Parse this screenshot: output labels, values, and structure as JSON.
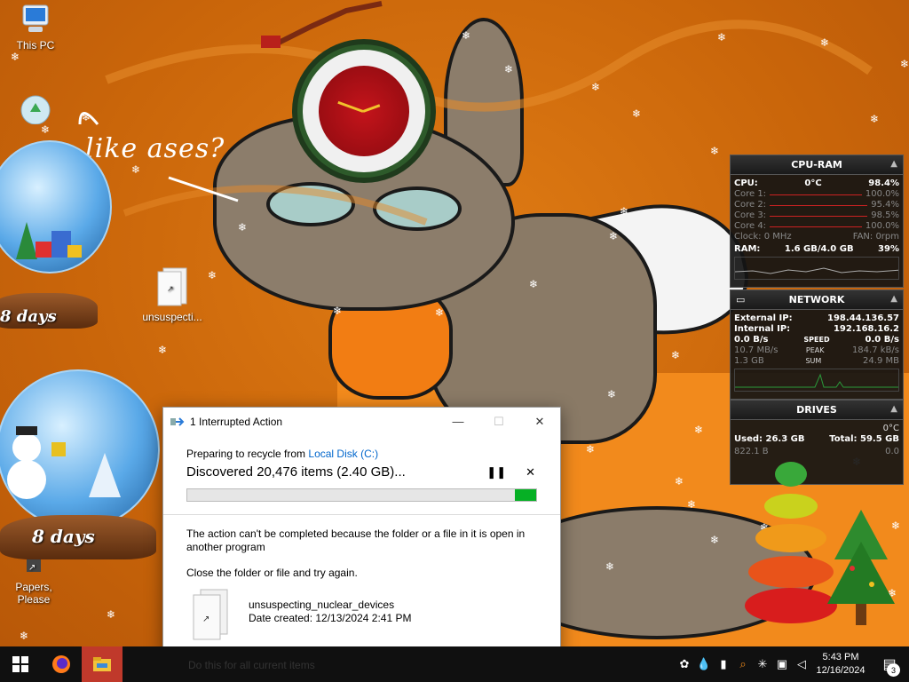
{
  "desktop": {
    "icons": [
      {
        "label": "This PC"
      },
      {
        "label": ""
      },
      {
        "label": "unsuspecti..."
      },
      {
        "label": "Papers, Please"
      }
    ],
    "handwriting": "like ases?",
    "globe_top_days": "8 days",
    "globe_bottom_days": "8 days"
  },
  "cpu_ram": {
    "title": "CPU-RAM",
    "cpu_label": "CPU:",
    "cpu_temp": "0°C",
    "cpu_pct": "98.4%",
    "cores": [
      {
        "label": "Core 1:",
        "value": "100.0%"
      },
      {
        "label": "Core 2:",
        "value": "95.4%"
      },
      {
        "label": "Core 3:",
        "value": "98.5%"
      },
      {
        "label": "Core 4:",
        "value": "100.0%"
      }
    ],
    "clock": "Clock: 0 MHz",
    "fan": "FAN: 0rpm",
    "ram_label": "RAM:",
    "ram_value": "1.6 GB/4.0 GB",
    "ram_pct": "39%"
  },
  "network": {
    "title": "NETWORK",
    "external_label": "External IP:",
    "external_ip": "198.44.136.57",
    "internal_label": "Internal IP:",
    "internal_ip": "192.168.16.2",
    "speed_left": "0.0 B/s",
    "speed_label": "SPEED",
    "speed_right": "0.0 B/s",
    "peak_left": "10.7 MB/s",
    "peak_label": "PEAK",
    "peak_right": "184.7 kB/s",
    "sum_left": "1.3 GB",
    "sum_label": "SUM",
    "sum_right": "24.9 MB"
  },
  "drives": {
    "title": "DRIVES",
    "temp": "0°C",
    "used": "Used: 26.3 GB",
    "total": "Total: 59.5 GB",
    "read": "822.1 B",
    "write": "0.0"
  },
  "dialog": {
    "title": "1 Interrupted Action",
    "prep_text": "Preparing to recycle from ",
    "prep_link": "Local Disk (C:)",
    "discovered": "Discovered 20,476 items (2.40 GB)...",
    "progress": 0.06,
    "message": "The action can't be completed because the folder or a file in it is open in another program",
    "instruction": "Close the folder or file and try again.",
    "file_name": "unsuspecting_nuclear_devices",
    "file_date": "Date created: 12/13/2024 2:41 PM",
    "hidden_checkbox": "Do this for all current items"
  },
  "taskbar": {
    "time": "5:43 PM",
    "date": "12/16/2024",
    "notification_count": "3"
  },
  "colors": {
    "accent_green": "#06b025",
    "link_blue": "#0066cc",
    "taskbar_active": "#c0392b"
  }
}
